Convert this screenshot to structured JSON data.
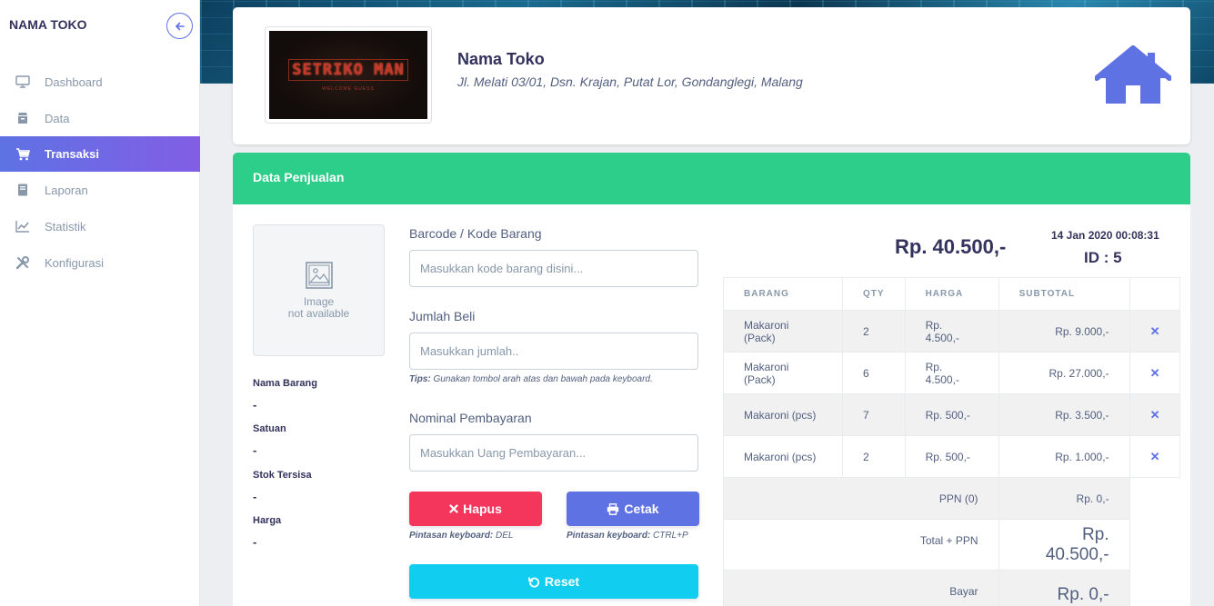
{
  "app": {
    "brand": "NAMA TOKO"
  },
  "sidebar": {
    "items": [
      {
        "label": "Dashboard",
        "icon": "monitor-icon"
      },
      {
        "label": "Data",
        "icon": "box-icon"
      },
      {
        "label": "Transaksi",
        "icon": "cart-icon",
        "active": true
      },
      {
        "label": "Laporan",
        "icon": "book-icon"
      },
      {
        "label": "Statistik",
        "icon": "chart-line-icon"
      },
      {
        "label": "Konfigurasi",
        "icon": "tools-icon"
      }
    ]
  },
  "store": {
    "name": "Nama Toko",
    "address": "Jl. Melati 03/01, Dsn. Krajan, Putat Lor, Gondanglegi, Malang",
    "logo_text": "SETRIKO MAN",
    "logo_subtext": "WELCOME GUESS"
  },
  "sales": {
    "title": "Data Penjualan",
    "image_placeholder": {
      "line1": "Image",
      "line2": "not available"
    },
    "info": [
      {
        "label": "Nama Barang",
        "value": "-"
      },
      {
        "label": "Satuan",
        "value": "-"
      },
      {
        "label": "Stok Tersisa",
        "value": "-"
      },
      {
        "label": "Harga",
        "value": "-"
      }
    ],
    "fields": {
      "barcode_label": "Barcode / Kode Barang",
      "barcode_placeholder": "Masukkan kode barang disini...",
      "qty_label": "Jumlah Beli",
      "qty_placeholder": "Masukkan jumlah..",
      "tips_bold": "Tips:",
      "tips_text": " Gunakan tombol arah atas dan bawah pada keyboard.",
      "payment_label": "Nominal Pembayaran",
      "payment_placeholder": "Masukkan Uang Pembayaran..."
    },
    "buttons": {
      "hapus": "Hapus",
      "cetak": "Cetak",
      "reset": "Reset",
      "hint_prefix": "Pintasan keyboard:",
      "hapus_key": " DEL",
      "cetak_key": " CTRL+P"
    },
    "total_display": "Rp. 40.500,-",
    "date": "14 Jan 2020 00:08:31",
    "id_label": "ID : 5"
  },
  "table": {
    "headers": [
      "BARANG",
      "QTY",
      "HARGA",
      "SUBTOTAL"
    ],
    "rows": [
      {
        "barang": "Makaroni (Pack)",
        "qty": "2",
        "harga": "Rp. 4.500,-",
        "subtotal": "Rp. 9.000,-"
      },
      {
        "barang": "Makaroni (Pack)",
        "qty": "6",
        "harga": "Rp. 4.500,-",
        "subtotal": "Rp. 27.000,-"
      },
      {
        "barang": "Makaroni (pcs)",
        "qty": "7",
        "harga": "Rp. 500,-",
        "subtotal": "Rp. 3.500,-"
      },
      {
        "barang": "Makaroni (pcs)",
        "qty": "2",
        "harga": "Rp. 500,-",
        "subtotal": "Rp. 1.000,-"
      }
    ],
    "remove_symbol": "✕",
    "summary": {
      "ppn_label": "PPN (0)",
      "ppn_value": "Rp. 0,-",
      "total_label": "Total + PPN",
      "total_value": "Rp. 40.500,-",
      "bayar_label": "Bayar",
      "bayar_value": "Rp. 0,-"
    }
  },
  "colors": {
    "primary": "#5e72e4",
    "success": "#2dce89",
    "danger": "#f5365c",
    "info": "#11cdef"
  }
}
